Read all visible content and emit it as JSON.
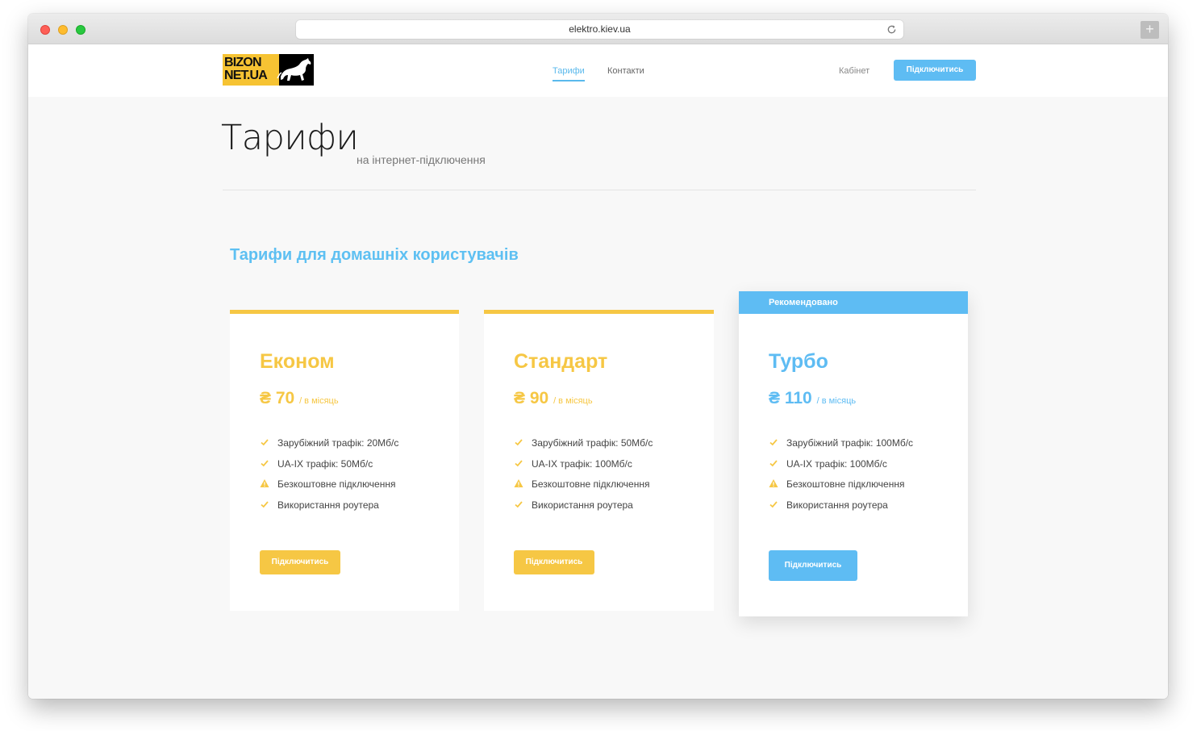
{
  "browser": {
    "url": "elektro.kiev.ua",
    "new_tab_label": "+"
  },
  "header": {
    "logo": {
      "line1": "BIZON",
      "line2": "NET.UA"
    },
    "nav": [
      {
        "label": "Тарифи",
        "active": true
      },
      {
        "label": "Контакти",
        "active": false
      }
    ],
    "cabinet_label": "Кабінет",
    "connect_label": "Підключитись"
  },
  "page": {
    "title": "Тарифи",
    "subtitle": "на інтернет-підключення",
    "section_title": "Тарифи для домашніх користувачів"
  },
  "plans": [
    {
      "name": "Економ",
      "currency": "₴",
      "price": "70",
      "period": "/ в місяць",
      "features": [
        {
          "text": "Зарубіжний трафік: 20Мб/с",
          "icon": "check-icon"
        },
        {
          "text": "UA-IX трафік: 50Мб/с",
          "icon": "check-icon"
        },
        {
          "text": "Безкоштовне підключення",
          "icon": "warning-icon"
        },
        {
          "text": "Використання роутера",
          "icon": "check-icon"
        }
      ],
      "button_label": "Підключитись",
      "accent": "#f6c744"
    },
    {
      "name": "Стандарт",
      "currency": "₴",
      "price": "90",
      "period": "/ в місяць",
      "features": [
        {
          "text": "Зарубіжний трафік: 50Мб/с",
          "icon": "check-icon"
        },
        {
          "text": "UA-IX трафік: 100Мб/с",
          "icon": "check-icon"
        },
        {
          "text": "Безкоштовне підключення",
          "icon": "warning-icon"
        },
        {
          "text": "Використання роутера",
          "icon": "check-icon"
        }
      ],
      "button_label": "Підключитись",
      "accent": "#f6c744"
    },
    {
      "name": "Турбо",
      "badge": "Рекомендовано",
      "currency": "₴",
      "price": "110",
      "period": "/ в місяць",
      "features": [
        {
          "text": "Зарубіжний трафік: 100Мб/с",
          "icon": "check-icon"
        },
        {
          "text": "UA-IX трафік: 100Мб/с",
          "icon": "check-icon"
        },
        {
          "text": "Безкоштовне підключення",
          "icon": "warning-icon"
        },
        {
          "text": "Використання роутера",
          "icon": "check-icon"
        }
      ],
      "button_label": "Підключитись",
      "accent": "#5ebcf3"
    }
  ],
  "colors": {
    "yellow": "#f6c744",
    "blue": "#5ebcf3"
  }
}
